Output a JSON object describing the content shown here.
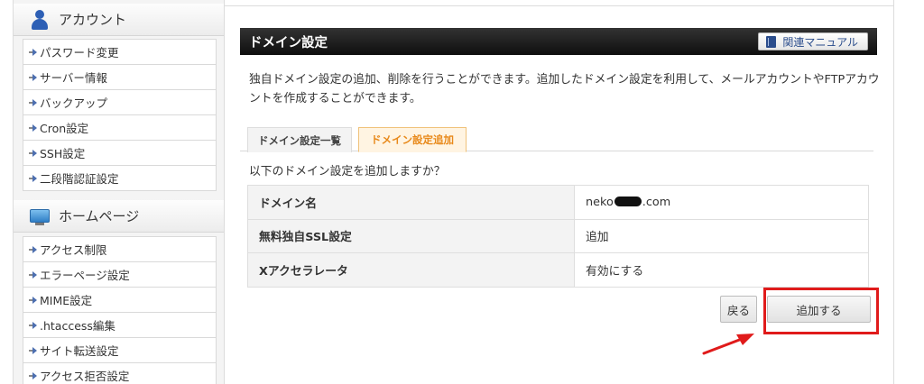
{
  "sidebar": {
    "account_section": {
      "title": "アカウント",
      "icon": "user-icon",
      "items": [
        {
          "label": "パスワード変更"
        },
        {
          "label": "サーバー情報"
        },
        {
          "label": "バックアップ"
        },
        {
          "label": "Cron設定"
        },
        {
          "label": "SSH設定"
        },
        {
          "label": "二段階認証設定"
        }
      ]
    },
    "homepage_section": {
      "title": "ホームページ",
      "icon": "monitor-icon",
      "items": [
        {
          "label": "アクセス制限"
        },
        {
          "label": "エラーページ設定"
        },
        {
          "label": "MIME設定"
        },
        {
          "label": ".htaccess編集"
        },
        {
          "label": "サイト転送設定"
        },
        {
          "label": "アクセス拒否設定"
        }
      ]
    }
  },
  "main": {
    "title": "ドメイン設定",
    "manual_button_label": "関連マニュアル",
    "description": "独自ドメイン設定の追加、削除を行うことができます。追加したドメイン設定を利用して、メールアカウントやFTPアカウントを作成することができます。",
    "tabs": [
      {
        "label": "ドメイン設定一覧",
        "active": false
      },
      {
        "label": "ドメイン設定追加",
        "active": true
      }
    ],
    "question": "以下のドメイン設定を追加しますか？",
    "table": [
      {
        "label": "ドメイン名",
        "value_prefix": "neko",
        "value_suffix": ".com"
      },
      {
        "label": "無料独自SSL設定",
        "value": "追加"
      },
      {
        "label": "Xアクセラレータ",
        "value": "有効にする"
      }
    ],
    "back_button_label": "戻る",
    "add_button_label": "追加する"
  },
  "colors": {
    "header_bg": "#111111",
    "active_tab_text": "#e8891a",
    "active_tab_bg": "#fff4e2",
    "highlight_red": "#e01b1b",
    "link_blue": "#2b4d8c"
  }
}
